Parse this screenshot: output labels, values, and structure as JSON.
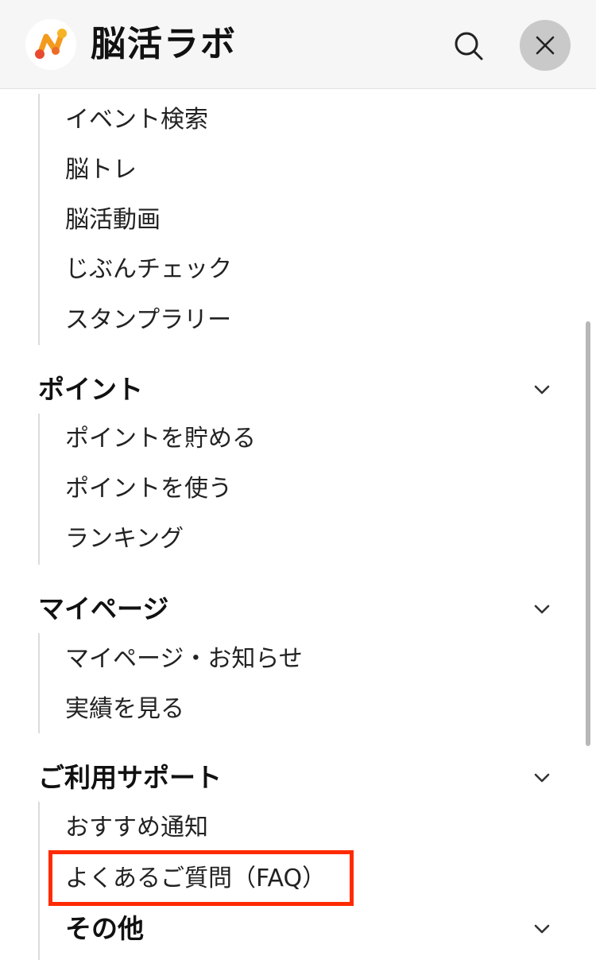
{
  "header": {
    "logo_text": "脳活ラボ",
    "logo_icon": "brain-lab-logo-icon",
    "search_icon": "search-icon",
    "close_icon": "close-icon"
  },
  "menu": {
    "top_group_items": [
      "イベント検索",
      "脳トレ",
      "脳活動画",
      "じぶんチェック",
      "スタンプラリー"
    ],
    "sections": [
      {
        "title": "ポイント",
        "items": [
          "ポイントを貯める",
          "ポイントを使う",
          "ランキング"
        ]
      },
      {
        "title": "マイページ",
        "items": [
          "マイページ・お知らせ",
          "実績を見る"
        ]
      },
      {
        "title": "ご利用サポート",
        "items": [
          "おすすめ通知",
          "よくあるご質問（FAQ）"
        ]
      },
      {
        "title": "その他",
        "items": []
      }
    ]
  },
  "colors": {
    "header_bg": "#f6f6f6",
    "highlight": "#ff2a00",
    "logo_orange": "#f39a1e",
    "logo_red": "#e84a2f"
  }
}
